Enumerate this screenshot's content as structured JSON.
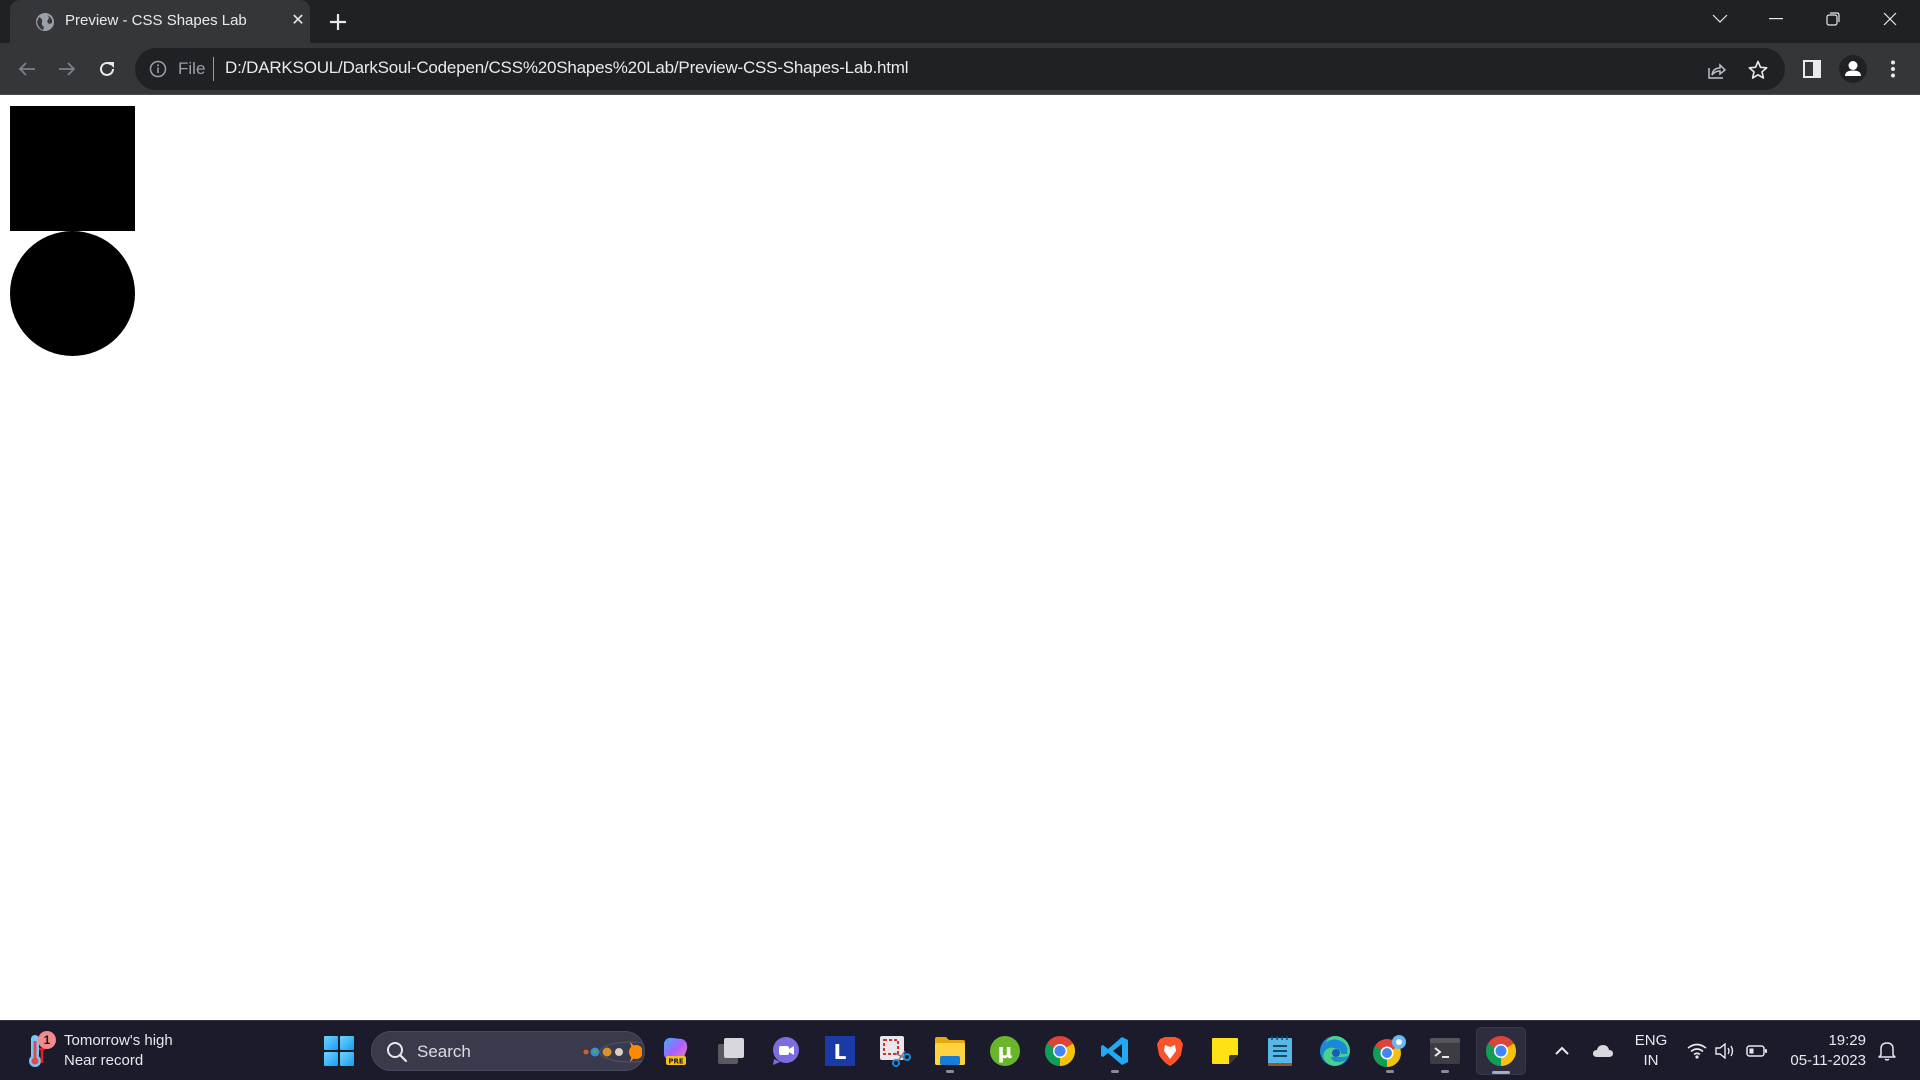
{
  "browser": {
    "tab": {
      "title": "Preview - CSS Shapes Lab",
      "favicon": "globe-icon",
      "close_glyph": "✕"
    },
    "new_tab_icon": "plus-icon",
    "window_controls": [
      "tab-search-icon",
      "minimize-icon",
      "restore-icon",
      "close-icon"
    ],
    "toolbar": {
      "back_icon": "arrow-left-icon",
      "forward_icon": "arrow-right-icon",
      "reload_icon": "reload-icon",
      "omnibox": {
        "security_icon": "info-icon",
        "scheme_label": "File",
        "url": "D:/DARKSOUL/DarkSoul-Codepen/CSS%20Shapes%20Lab/Preview-CSS-Shapes-Lab.html",
        "share_icon": "share-icon",
        "bookmark_icon": "star-icon"
      },
      "side_panel_icon": "side-panel-icon",
      "profile_icon": "profile-icon",
      "menu_icon": "kebab-menu-icon"
    }
  },
  "page": {
    "shapes": [
      {
        "type": "square",
        "color": "#000000"
      },
      {
        "type": "circle",
        "color": "#000000"
      }
    ]
  },
  "taskbar": {
    "weather": {
      "badge": "1",
      "line1": "Tomorrow's high",
      "line2": "Near record"
    },
    "search_label": "Search",
    "apps": [
      {
        "name": "copilot-preview",
        "icon": "copilot-icon",
        "badge": "PRE",
        "running": false
      },
      {
        "name": "task-view",
        "icon": "task-view-icon",
        "running": false
      },
      {
        "name": "teams-chat",
        "icon": "teams-chat-icon",
        "running": false
      },
      {
        "name": "l-app",
        "icon": "l-app-icon",
        "label": "L",
        "running": false
      },
      {
        "name": "snipping-tool",
        "icon": "snipping-tool-icon",
        "running": false
      },
      {
        "name": "file-explorer",
        "icon": "folder-icon",
        "running": true
      },
      {
        "name": "utorrent",
        "icon": "utorrent-icon",
        "label": "µ",
        "running": false
      },
      {
        "name": "chrome",
        "icon": "chrome-icon",
        "running": false
      },
      {
        "name": "vscode",
        "icon": "vscode-icon",
        "running": true
      },
      {
        "name": "brave",
        "icon": "brave-icon",
        "running": false
      },
      {
        "name": "sticky-notes",
        "icon": "sticky-notes-icon",
        "running": false
      },
      {
        "name": "notepad",
        "icon": "notepad-icon",
        "running": false
      },
      {
        "name": "edge",
        "icon": "edge-icon",
        "running": false
      },
      {
        "name": "chrome-profile",
        "icon": "chrome-profile-icon",
        "running": true
      },
      {
        "name": "terminal",
        "icon": "terminal-icon",
        "running": true
      },
      {
        "name": "chrome-active",
        "icon": "chrome-icon",
        "running": true,
        "active": true
      }
    ],
    "tray": {
      "overflow_icon": "chevron-up-icon",
      "onedrive_icon": "cloud-icon",
      "lang_line1": "ENG",
      "lang_line2": "IN",
      "wifi_icon": "wifi-icon",
      "volume_icon": "volume-icon",
      "battery_icon": "battery-icon",
      "time": "19:29",
      "date": "05-11-2023",
      "notification_icon": "bell-icon"
    }
  }
}
